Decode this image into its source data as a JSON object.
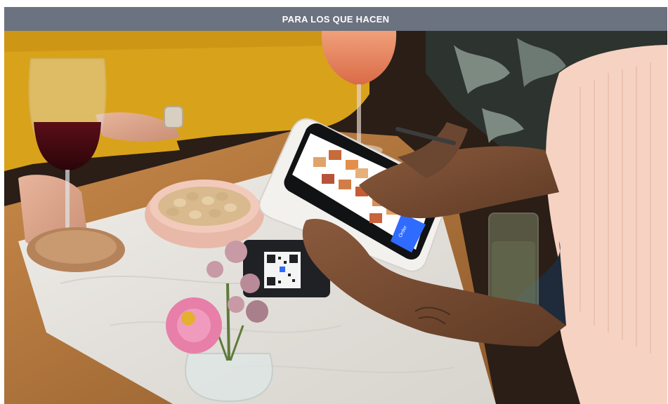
{
  "banner": {
    "title": "PARA LOS QUE HACEN"
  },
  "hero": {
    "device_screen": {
      "action_button_label": "Order"
    }
  },
  "colors": {
    "banner_background": "#6b7280",
    "banner_text": "#ffffff",
    "sweater_mustard": "#d9a21b",
    "table_wood": "#b77a3f",
    "marble": "#e9e6e1",
    "device_white": "#f3f1ee",
    "screen_button_blue": "#2f6bff",
    "shirt_peach": "#f6d2c2"
  }
}
